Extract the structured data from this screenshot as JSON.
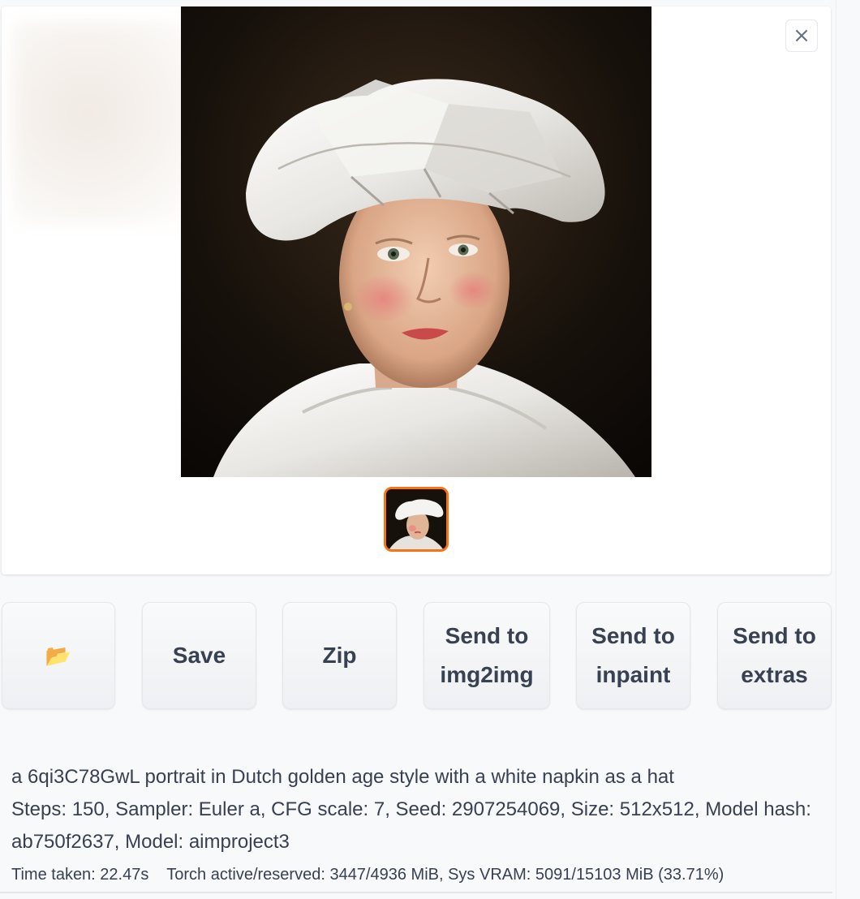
{
  "gallery": {
    "image_description_icon": "portrait-image",
    "close_icon": "×"
  },
  "buttons": {
    "folder_icon": "📂",
    "save_label": "Save",
    "zip_label": "Zip",
    "send_img2img_label": "Send to\nimg2img",
    "send_inpaint_label": "Send to\ninpaint",
    "send_extras_label": "Send to\nextras"
  },
  "generation_info": {
    "prompt": "a 6qi3C78GwL portrait in Dutch golden age style with a white napkin as a hat",
    "parameters": "Steps: 150, Sampler: Euler a, CFG scale: 7, Seed: 2907254069, Size: 512x512, Model hash: ab750f2637, Model: aimproject3"
  },
  "performance": {
    "time_taken": "Time taken: 22.47s",
    "memory": "Torch active/reserved: 3447/4936 MiB, Sys VRAM: 5091/15103 MiB (33.71%)"
  },
  "colors": {
    "accent": "#f97316",
    "background": "#f8f9fb",
    "text": "#374151"
  }
}
